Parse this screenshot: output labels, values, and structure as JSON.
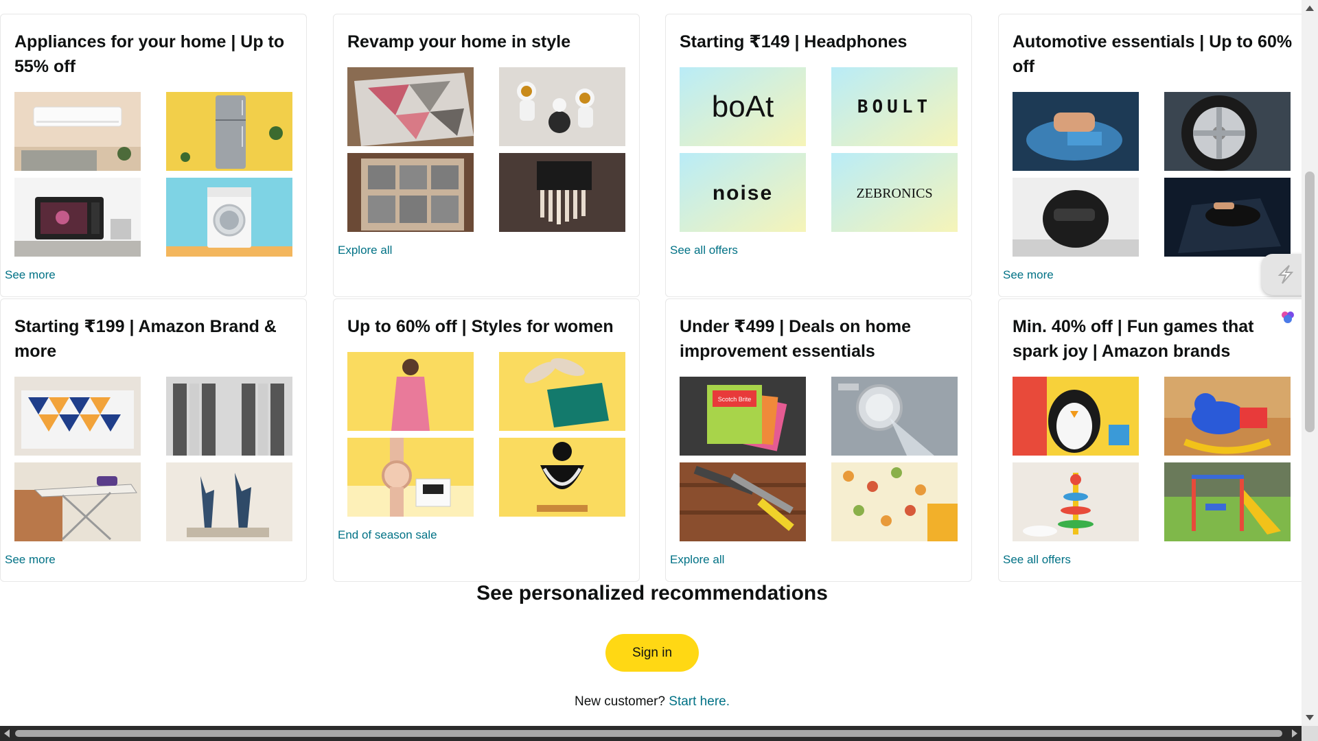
{
  "cards": [
    {
      "title": "Appliances for your home | Up to 55% off",
      "link": "See more",
      "tiles": [
        "air-conditioner",
        "refrigerator",
        "microwave",
        "washing-machine"
      ]
    },
    {
      "title": "Revamp your home in style",
      "link": "Explore all",
      "tiles": [
        "rug",
        "astronaut-figurines",
        "storage-shelf",
        "wall-lamp"
      ]
    },
    {
      "title": "Starting ₹149 | Headphones",
      "link": "See all offers",
      "tiles": [
        "boat-logo",
        "boult-logo",
        "noise-logo",
        "zebronics-logo"
      ],
      "brands": [
        "boAt",
        "BOULT",
        "noise",
        "ZEBRONICS"
      ]
    },
    {
      "title": "Automotive essentials | Up to 60% off",
      "link": "See more",
      "tiles": [
        "car-cleaning",
        "tyre-cleaning",
        "helmet",
        "car-vacuum"
      ]
    },
    {
      "title": "Starting ₹199 | Amazon Brand & more",
      "link": "See more",
      "tiles": [
        "bedsheet",
        "curtains",
        "ironing-board",
        "deer-figurines"
      ]
    },
    {
      "title": "Up to 60% off | Styles for women",
      "link": "End of season sale",
      "tiles": [
        "women-dress",
        "heels-and-bag",
        "watch",
        "necklace"
      ]
    },
    {
      "title": "Under ₹499 | Deals on home improvement essentials",
      "link": "Explore all",
      "tiles": [
        "scrub-pads",
        "shower-head",
        "tools",
        "wallpaper"
      ],
      "badge": "Scotch Brite"
    },
    {
      "title": "Min. 40% off | Fun games that spark joy | Amazon brands",
      "link": "See all offers",
      "tiles": [
        "penguin-toy",
        "rocking-toy",
        "stacking-toy",
        "swing-slide"
      ]
    }
  ],
  "recommendations": {
    "title": "See personalized recommendations",
    "signin_label": "Sign in",
    "new_customer_text": "New customer?",
    "start_here_label": "Start here."
  },
  "colors": {
    "link": "#007185",
    "signin_button": "#ffd814",
    "text": "#0f1111"
  }
}
